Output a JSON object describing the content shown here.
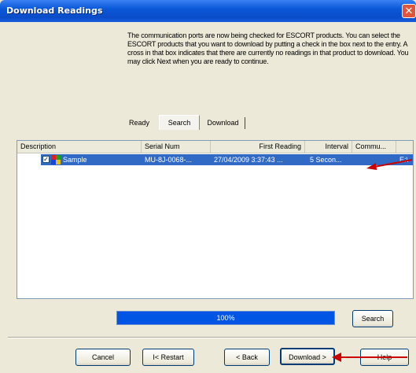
{
  "window": {
    "title": "Download Readings",
    "close_glyph": "✕"
  },
  "instructions": "The communication ports are now being checked for ESCORT products. You can select the ESCORT products that you want to download by putting a check in the box next to the entry. A cross in that box indicates that there are currently no readings in that product to download. You may click Next when you are ready to continue.",
  "tabs": [
    {
      "label": "Ready"
    },
    {
      "label": "Search",
      "selected": true
    },
    {
      "label": "Download"
    }
  ],
  "list": {
    "columns": [
      "Description",
      "Serial Num",
      "First Reading",
      "Interval",
      "Commu..."
    ],
    "rows": [
      {
        "checked": true,
        "checkbox_glyph": "✓",
        "icon": "logger-flag-icon",
        "description": "Sample",
        "serial": "MU-8J-0068-...",
        "first_reading": "27/04/2009 3:37:43 ...",
        "interval": "5 Secon...",
        "comms": "E:\\"
      }
    ]
  },
  "progress": {
    "value": 1.0,
    "label": "100%"
  },
  "buttons": {
    "search": "Search",
    "cancel": "Cancel",
    "restart": "I< Restart",
    "back": "< Back",
    "download": "Download >",
    "help": "Help"
  },
  "colors": {
    "selection": "#316ac5",
    "progress": "#0055e5",
    "annotation_arrow": "#cc0000"
  }
}
